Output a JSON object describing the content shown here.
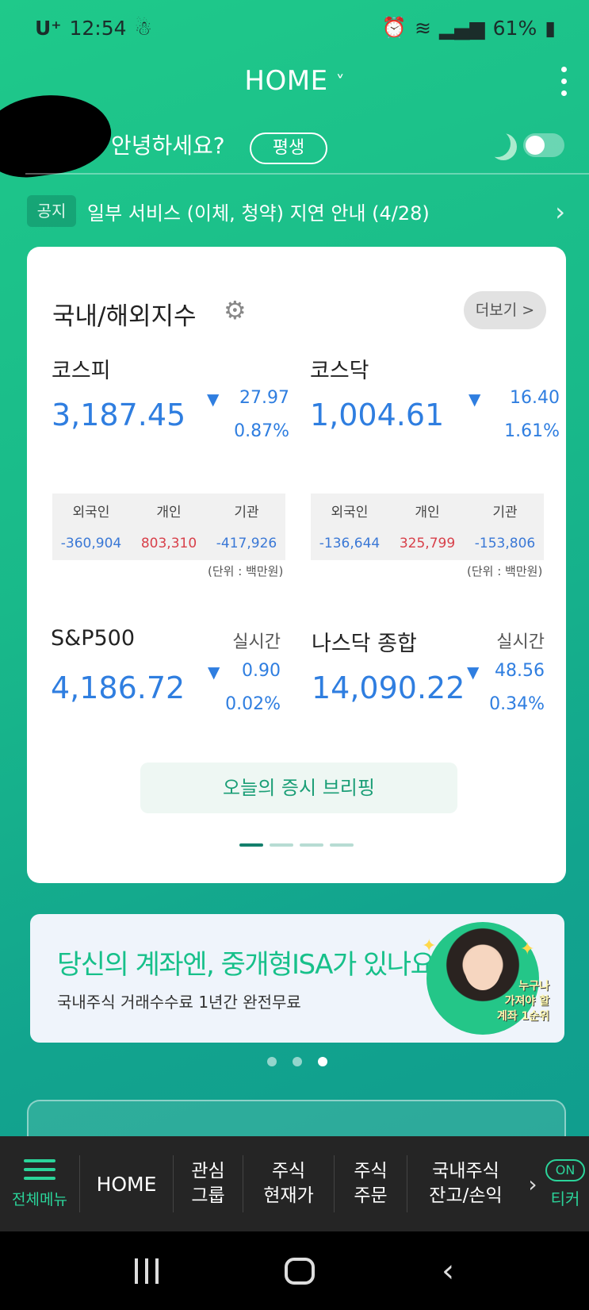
{
  "status_bar": {
    "carrier": "U⁺",
    "time": "12:54",
    "battery": "61%"
  },
  "header": {
    "title": "HOME",
    "chevron": "˅"
  },
  "greeting": {
    "text": "안녕하세요?",
    "grade_badge": "평생",
    "dark_mode_toggle": "off"
  },
  "notice": {
    "badge": "공지",
    "text": "일부 서비스 (이체, 청약) 지연 안내 (4/28)"
  },
  "index_card": {
    "title": "국내/해외지수",
    "more_label": "더보기 >",
    "indices": [
      {
        "name": "코스피",
        "value": "3,187.45",
        "change": "27.97",
        "pct": "0.87%",
        "direction": "down",
        "realtime": ""
      },
      {
        "name": "코스닥",
        "value": "1,004.61",
        "change": "16.40",
        "pct": "1.61%",
        "direction": "down",
        "realtime": ""
      },
      {
        "name": "S&P500",
        "value": "4,186.72",
        "change": "0.90",
        "pct": "0.02%",
        "direction": "down",
        "realtime": "실시간"
      },
      {
        "name": "나스닥 종합",
        "value": "14,090.22",
        "change": "48.56",
        "pct": "0.34%",
        "direction": "down",
        "realtime": "실시간"
      }
    ],
    "investor_headers": [
      "외국인",
      "개인",
      "기관"
    ],
    "kospi_investors": [
      "-360,904",
      "803,310",
      "-417,926"
    ],
    "kosdaq_investors": [
      "-136,644",
      "325,799",
      "-153,806"
    ],
    "unit_note": "(단위 : 백만원)",
    "briefing_label": "오늘의 증시 브리핑",
    "page_count": 4,
    "active_page": 1
  },
  "ad_banner": {
    "title": "당신의 계좌엔, 중개형ISA가 있나요?",
    "subtitle": "국내주식 거래수수료 1년간 완전무료",
    "sticker_line1": "누구나",
    "sticker_line2": "가져야 할",
    "sticker_line3": "계좌 1순위",
    "dot_count": 3,
    "active_dot": 3
  },
  "bottom_nav": {
    "menu_label": "전체메뉴",
    "items": [
      "HOME",
      "관심\n그룹",
      "주식\n현재가",
      "주식\n주문",
      "국내주식\n잔고/손익"
    ],
    "ticker_on": "ON",
    "ticker_label": "티커"
  },
  "colors": {
    "accent_green": "#1fc98a",
    "down_blue": "#2f7ee0",
    "up_red": "#d8404a"
  }
}
